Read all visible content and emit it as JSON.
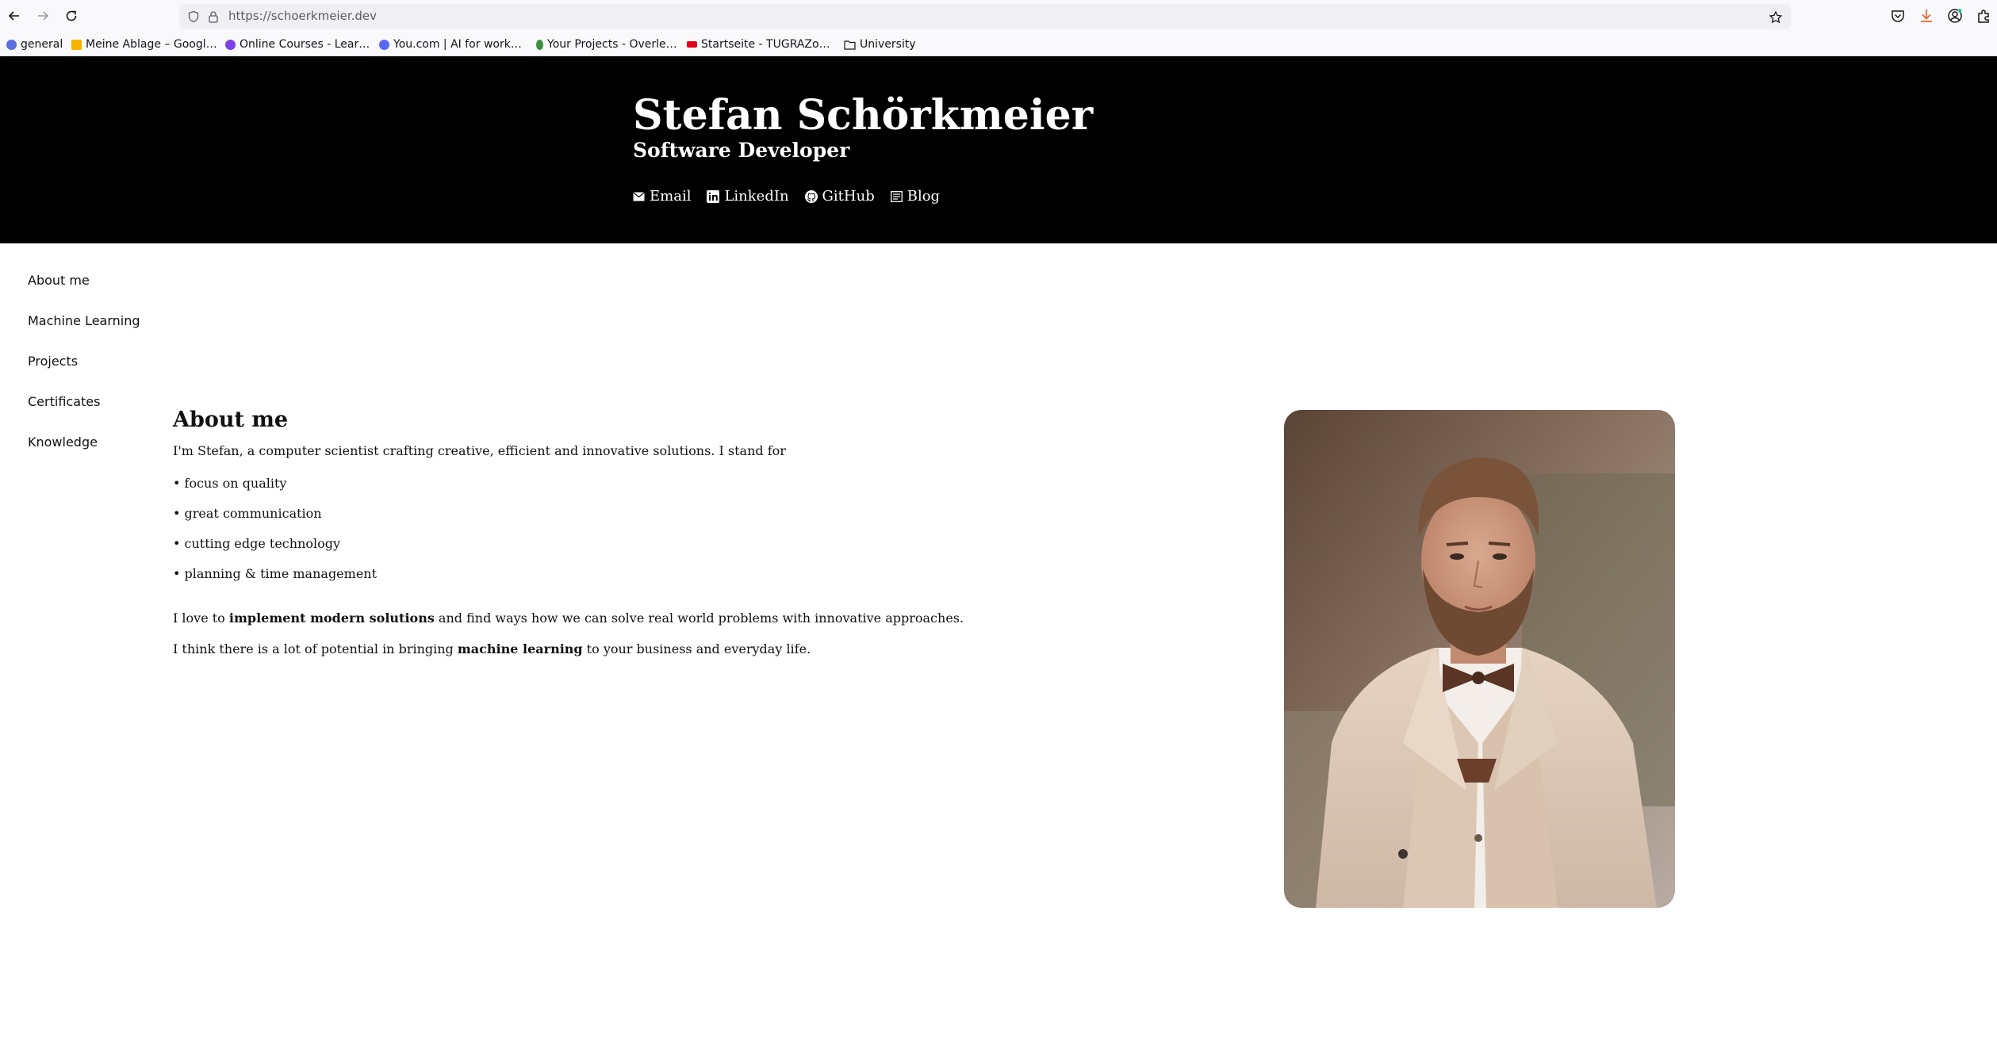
{
  "browser": {
    "url": "https://schoerkmeier.dev",
    "bookmarks": [
      {
        "label": "general",
        "color": "#5b6ee1"
      },
      {
        "label": "Meine Ablage – Googl…",
        "color": "#f4b400"
      },
      {
        "label": "Online Courses - Lear…",
        "color": "#7b3fe4"
      },
      {
        "label": "You.com | AI for work…",
        "color": "#5a67f2"
      },
      {
        "label": "Your Projects - Overle…",
        "color": "#3e8e41"
      },
      {
        "label": "Startseite - TUGRAZo…",
        "color": "#e2001a"
      },
      {
        "label": "University",
        "color": "#555555"
      }
    ]
  },
  "header": {
    "name": "Stefan Schörkmeier",
    "role": "Software Developer",
    "links": [
      {
        "label": "Email",
        "icon": "mail-icon"
      },
      {
        "label": "LinkedIn",
        "icon": "linkedin-icon"
      },
      {
        "label": "GitHub",
        "icon": "github-icon"
      },
      {
        "label": "Blog",
        "icon": "blog-icon"
      }
    ]
  },
  "sidebar": {
    "items": [
      {
        "label": "About me"
      },
      {
        "label": "Machine Learning"
      },
      {
        "label": "Projects"
      },
      {
        "label": "Certificates"
      },
      {
        "label": "Knowledge"
      }
    ]
  },
  "about": {
    "title": "About me",
    "intro": "I'm Stefan, a computer scientist crafting creative, efficient and innovative solutions. I stand for",
    "bullets": [
      "• focus on quality",
      "• great communication",
      "• cutting edge technology",
      "• planning & time management"
    ],
    "para1_pre": "I love to ",
    "para1_bold": "implement modern solutions",
    "para1_post": " and find ways how we can solve real world problems with innovative approaches.",
    "para2_pre": "I think there is a lot of potential in bringing ",
    "para2_bold": "machine learning",
    "para2_post": " to your business and everyday life."
  },
  "colors": {
    "header_bg": "#000000",
    "accent_download": "#e8632b"
  }
}
